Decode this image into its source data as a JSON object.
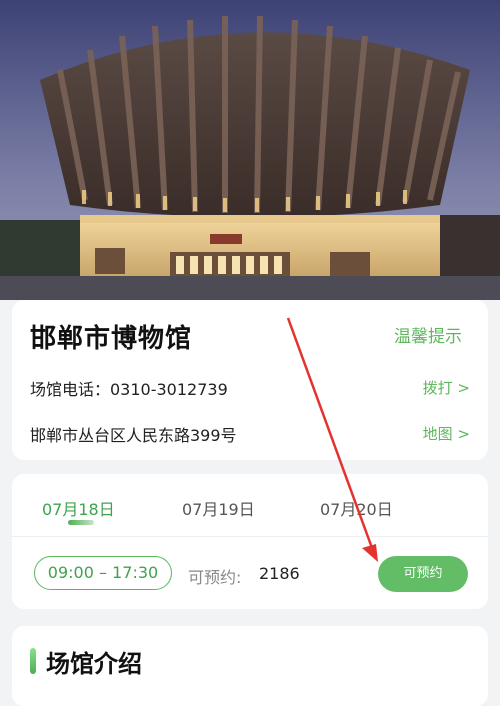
{
  "hero": {
    "image": "opera-house-photo"
  },
  "venue": {
    "name": "邯郸市博物馆",
    "tip_link": "温馨提示",
    "phone_text": "场馆电话：0310-3012739",
    "call_link": "拨打 >",
    "address": "邯郸市丛台区人民东路399号",
    "map_link": "地图 >"
  },
  "dates": {
    "tabs": [
      {
        "label": "07月18日",
        "active": true
      },
      {
        "label": "07月19日",
        "active": false
      },
      {
        "label": "07月20日",
        "active": false
      }
    ]
  },
  "slot": {
    "time": "09:00 – 17:30",
    "available_label": "可预约:",
    "available_count": "2186",
    "book_button": "可预约"
  },
  "intro": {
    "title": "场馆介绍"
  },
  "colors": {
    "accent": "#5cb85c",
    "arrow": "#e5322d"
  }
}
